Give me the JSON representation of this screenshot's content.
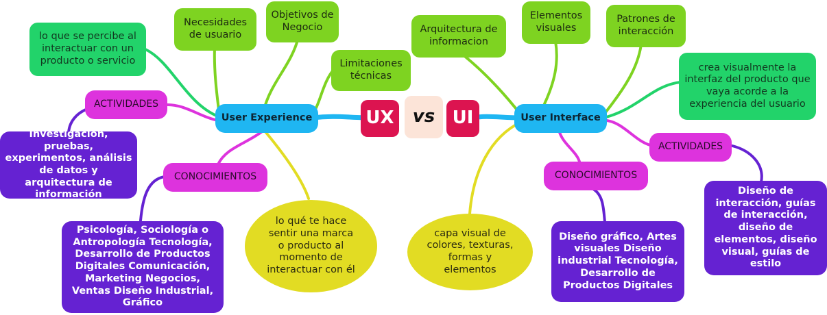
{
  "center": {
    "ux": "UX",
    "vs": "vs",
    "ui": "UI"
  },
  "ux_side": {
    "title": "User Experience",
    "percepcion": "lo que se percibe al interactuar con un producto o servicio",
    "necesidades": "Necesidades de usuario",
    "objetivos": "Objetivos de Negocio",
    "limitaciones": "Limitaciones técnicas",
    "actividades_label": "ACTIVIDADES",
    "actividades_text": "Investigación, pruebas, experimentos, análisis de datos y arquitectura de información",
    "conocimientos_label": "CONOCIMIENTOS",
    "conocimientos_text": "Psicología, Sociología o Antropología Tecnología, Desarrollo de Productos Digitales Comunicación, Marketing Negocios, Ventas Diseño Industrial, Gráfico",
    "sentir": "lo qué te hace sentir una marca o producto al momento de interactuar con él"
  },
  "ui_side": {
    "title": "User Interface",
    "arquitectura": "Arquitectura de informacion",
    "elementos": "Elementos visuales",
    "patrones": "Patrones de interacción",
    "crea": "crea visualmente la interfaz del producto que vaya acorde a la experiencia del usuario",
    "actividades_label": "ACTIVIDADES",
    "actividades_text": "Diseño de interacción, guías de interacción, diseño de elementos, diseño visual, guías de estilo",
    "conocimientos_label": "CONOCIMIENTOS",
    "conocimientos_text": "Diseño gráfico, Artes visuales Diseño industrial Tecnología, Desarrollo de Productos Digitales",
    "capa": "capa visual de colores, texturas, formas y elementos"
  },
  "colors": {
    "green": "#7ed321",
    "mint": "#22d36a",
    "magenta": "#dd33dd",
    "purple": "#6522d2",
    "yellow": "#e2dc23",
    "blue": "#1fb6f2",
    "crimson": "#dc1450",
    "peach": "#fce4d8"
  }
}
